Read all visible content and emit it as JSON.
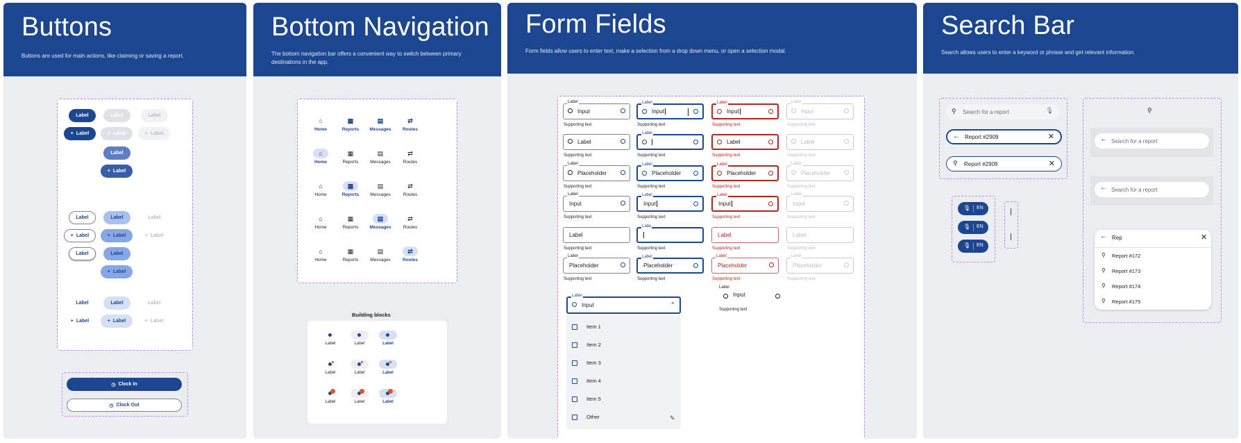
{
  "buttons": {
    "title": "Buttons",
    "desc": "Buttons are used for main actions, like claiming or saving a report.",
    "label": "Label",
    "plus_label": "+ Label",
    "clock_in": "Clock In",
    "clock_out": "Clock Out"
  },
  "bottom_nav": {
    "title": "Bottom Navigation",
    "desc1": "The bottom navigation bar offers a convenient way to switch between primary",
    "desc2": "destinations in the app.",
    "items": [
      "Home",
      "Reports",
      "Messages",
      "Routes"
    ],
    "building_blocks": "Building blocks",
    "block_label": "Label"
  },
  "form_fields": {
    "title": "Form Fields",
    "desc": "Form fields allow users to enter text, make a selection from a drop down menu, or open a selection modal.",
    "label": "Label",
    "label_trunc": "Labe",
    "input": "Input",
    "placeholder": "Placeholder",
    "supporting": "Supporting text",
    "dropdown_items": [
      "Item 1",
      "Item 2",
      "Item 3",
      "Item 4",
      "Item 5",
      "Other"
    ]
  },
  "search_bar": {
    "title": "Search Bar",
    "desc": "Search allows users to enter a keyword or phrase and get relevant information.",
    "placeholder": "Search for a report",
    "query1": "Report #2909",
    "query2": "Report #2909",
    "typed": "Rep",
    "lang": "EN",
    "results": [
      "Report #172",
      "Report #173",
      "Report #174",
      "Report #175"
    ]
  },
  "colors": {
    "primary": "#1d4690",
    "error": "#b3261e",
    "frame": "#b78ef0",
    "panel": "#ecedf0"
  }
}
